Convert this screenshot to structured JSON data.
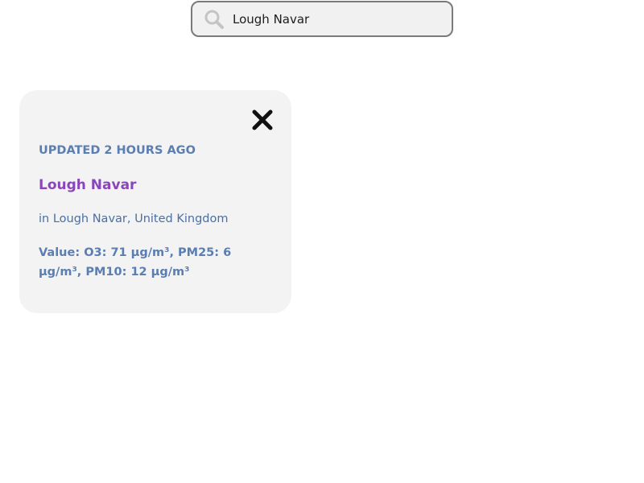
{
  "search": {
    "value": "Lough Navar",
    "icon": "search-icon"
  },
  "card": {
    "close_icon": "close-icon",
    "updated": "UPDATED 2 HOURS AGO",
    "location_name": "Lough Navar",
    "location_sub": "in Lough Navar, United Kingdom",
    "values": "Value: O3: 71 µg/m³, PM25: 6 µg/m³, PM10: 12 µg/m³"
  },
  "colors": {
    "accent_purple": "#8a46b8",
    "accent_blue": "#5b7eb2",
    "card_bg": "#f3f3f3"
  }
}
